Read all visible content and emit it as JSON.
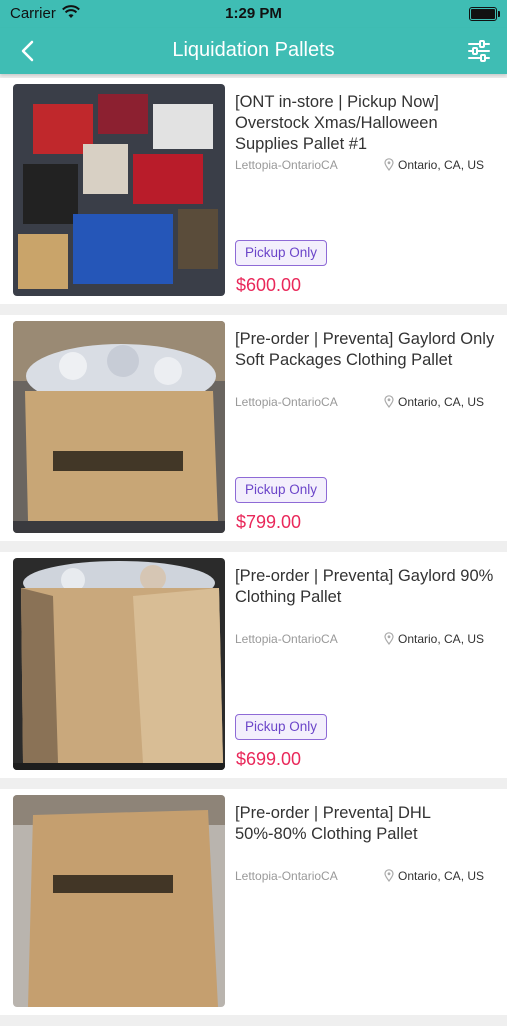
{
  "status": {
    "carrier": "Carrier",
    "time": "1:29 PM"
  },
  "header": {
    "title": "Liquidation Pallets",
    "back_icon": "back-arrow-icon",
    "filter_icon": "sliders-icon"
  },
  "colors": {
    "accent": "#3fbdb4",
    "price": "#e9285a",
    "badge": "#6b45c9"
  },
  "listings": [
    {
      "title": "[ONT in-store | Pickup Now] Overstock Xmas/Halloween Supplies Pallet #1",
      "seller": "Lettopia-OntarioCA",
      "location": "Ontario, CA, US",
      "badge": "Pickup Only",
      "price": "$600.00"
    },
    {
      "title": "[Pre-order | Preventa] Gaylord Only Soft Packages Clothing Pallet",
      "seller": "Lettopia-OntarioCA",
      "location": "Ontario, CA, US",
      "badge": "Pickup Only",
      "price": "$799.00"
    },
    {
      "title": "[Pre-order | Preventa] Gaylord 90% Clothing Pallet",
      "seller": "Lettopia-OntarioCA",
      "location": "Ontario, CA, US",
      "badge": "Pickup Only",
      "price": "$699.00"
    },
    {
      "title": "[Pre-order | Preventa] DHL 50%-80% Clothing Pallet",
      "seller": "Lettopia-OntarioCA",
      "location": "Ontario, CA, US",
      "badge": "",
      "price": ""
    }
  ]
}
